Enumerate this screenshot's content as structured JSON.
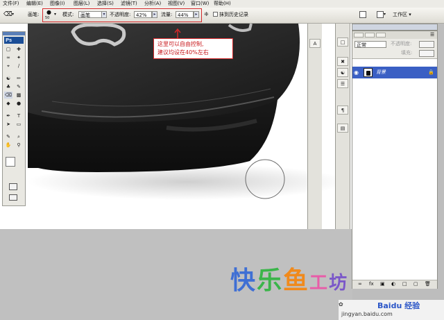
{
  "menu": [
    "文件(F)",
    "编辑(E)",
    "图像(I)",
    "图层(L)",
    "选择(S)",
    "滤镜(T)",
    "分析(A)",
    "视图(V)",
    "窗口(W)",
    "帮助(H)"
  ],
  "options": {
    "brush_label": "画笔:",
    "brush_size": "50",
    "mode_label": "模式:",
    "mode_value": "画笔",
    "opacity_label": "不透明度:",
    "opacity_value": "42%",
    "flow_label": "流量:",
    "flow_value": "44%",
    "history_label": "抹到历史记录",
    "workspace_label": "工作区 ▾"
  },
  "callout": {
    "line1": "这里可以自由控制,",
    "line2": "建议均设在40%左右"
  },
  "toolbox": {
    "logo": "Ps"
  },
  "layers": {
    "blend_mode": "正常",
    "opacity_label": "不透明度:",
    "fill_label": "填充:",
    "layer_name": "背景"
  },
  "watermark": {
    "chars": [
      "快",
      "乐",
      "鱼",
      "工",
      "坊"
    ],
    "colors": [
      "#3f6fd4",
      "#3bb54a",
      "#f08a1c",
      "#e85ca8",
      "#7a57c9"
    ]
  },
  "footer": {
    "site": "jingyan.baidu.com",
    "brand": "Baidu 经验"
  },
  "colors": {
    "accent_red": "#d4282a",
    "layer_selected": "#3a5fc4"
  }
}
